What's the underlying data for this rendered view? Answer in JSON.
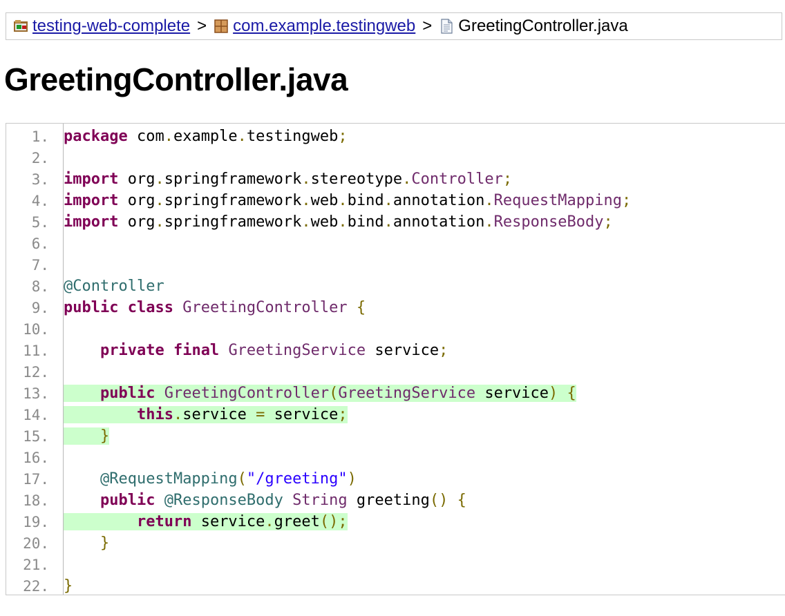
{
  "breadcrumb": {
    "project": "testing-web-complete",
    "separator1": ">",
    "package": "com.example.testingweb",
    "separator2": ">",
    "file": "GreetingController.java",
    "icons": [
      "project-icon",
      "package-icon",
      "java-file-icon"
    ]
  },
  "page_title": "GreetingController.java",
  "code": {
    "line_numbers": [
      "1.",
      "2.",
      "3.",
      "4.",
      "5.",
      "6.",
      "7.",
      "8.",
      "9.",
      "10.",
      "11.",
      "12.",
      "13.",
      "14.",
      "15.",
      "16.",
      "17.",
      "18.",
      "19.",
      "20.",
      "21.",
      "22."
    ],
    "lines": [
      [
        {
          "t": "package",
          "c": "kw"
        },
        {
          "t": " com"
        },
        {
          "t": ".",
          "c": "pn"
        },
        {
          "t": "example"
        },
        {
          "t": ".",
          "c": "pn"
        },
        {
          "t": "testingweb"
        },
        {
          "t": ";",
          "c": "pn"
        }
      ],
      [],
      [
        {
          "t": "import",
          "c": "kw"
        },
        {
          "t": " org"
        },
        {
          "t": ".",
          "c": "pn"
        },
        {
          "t": "springframework"
        },
        {
          "t": ".",
          "c": "pn"
        },
        {
          "t": "stereotype"
        },
        {
          "t": ".",
          "c": "pn"
        },
        {
          "t": "Controller",
          "c": "ty"
        },
        {
          "t": ";",
          "c": "pn"
        }
      ],
      [
        {
          "t": "import",
          "c": "kw"
        },
        {
          "t": " org"
        },
        {
          "t": ".",
          "c": "pn"
        },
        {
          "t": "springframework"
        },
        {
          "t": ".",
          "c": "pn"
        },
        {
          "t": "web"
        },
        {
          "t": ".",
          "c": "pn"
        },
        {
          "t": "bind"
        },
        {
          "t": ".",
          "c": "pn"
        },
        {
          "t": "annotation"
        },
        {
          "t": ".",
          "c": "pn"
        },
        {
          "t": "RequestMapping",
          "c": "ty"
        },
        {
          "t": ";",
          "c": "pn"
        }
      ],
      [
        {
          "t": "import",
          "c": "kw"
        },
        {
          "t": " org"
        },
        {
          "t": ".",
          "c": "pn"
        },
        {
          "t": "springframework"
        },
        {
          "t": ".",
          "c": "pn"
        },
        {
          "t": "web"
        },
        {
          "t": ".",
          "c": "pn"
        },
        {
          "t": "bind"
        },
        {
          "t": ".",
          "c": "pn"
        },
        {
          "t": "annotation"
        },
        {
          "t": ".",
          "c": "pn"
        },
        {
          "t": "ResponseBody",
          "c": "ty"
        },
        {
          "t": ";",
          "c": "pn"
        }
      ],
      [],
      [],
      [
        {
          "t": "@Controller",
          "c": "an"
        }
      ],
      [
        {
          "t": "public",
          "c": "kw"
        },
        {
          "t": " "
        },
        {
          "t": "class",
          "c": "kw"
        },
        {
          "t": " "
        },
        {
          "t": "GreetingController",
          "c": "ty"
        },
        {
          "t": " "
        },
        {
          "t": "{",
          "c": "pn"
        }
      ],
      [],
      [
        {
          "t": "    "
        },
        {
          "t": "private",
          "c": "kw"
        },
        {
          "t": " "
        },
        {
          "t": "final",
          "c": "kw"
        },
        {
          "t": " "
        },
        {
          "t": "GreetingService",
          "c": "ty"
        },
        {
          "t": " service"
        },
        {
          "t": ";",
          "c": "pn"
        }
      ],
      [],
      [
        {
          "t": "    "
        },
        {
          "t": "public",
          "c": "kw"
        },
        {
          "t": " "
        },
        {
          "t": "GreetingController",
          "c": "ty"
        },
        {
          "t": "(",
          "c": "pn"
        },
        {
          "t": "GreetingService",
          "c": "ty"
        },
        {
          "t": " service"
        },
        {
          "t": ")",
          "c": "pn"
        },
        {
          "t": " "
        },
        {
          "t": "{",
          "c": "pn"
        }
      ],
      [
        {
          "t": "        "
        },
        {
          "t": "this",
          "c": "kw"
        },
        {
          "t": ".",
          "c": "pn"
        },
        {
          "t": "service "
        },
        {
          "t": "=",
          "c": "pn"
        },
        {
          "t": " service"
        },
        {
          "t": ";",
          "c": "pn"
        }
      ],
      [
        {
          "t": "    "
        },
        {
          "t": "}",
          "c": "pn"
        }
      ],
      [],
      [
        {
          "t": "    "
        },
        {
          "t": "@RequestMapping",
          "c": "an"
        },
        {
          "t": "(",
          "c": "pn"
        },
        {
          "t": "\"/greeting\"",
          "c": "str"
        },
        {
          "t": ")",
          "c": "pn"
        }
      ],
      [
        {
          "t": "    "
        },
        {
          "t": "public",
          "c": "kw"
        },
        {
          "t": " "
        },
        {
          "t": "@ResponseBody",
          "c": "an"
        },
        {
          "t": " "
        },
        {
          "t": "String",
          "c": "ty"
        },
        {
          "t": " greeting"
        },
        {
          "t": "()",
          "c": "pn"
        },
        {
          "t": " "
        },
        {
          "t": "{",
          "c": "pn"
        }
      ],
      [
        {
          "t": "        "
        },
        {
          "t": "return",
          "c": "kw"
        },
        {
          "t": " service"
        },
        {
          "t": ".",
          "c": "pn"
        },
        {
          "t": "greet"
        },
        {
          "t": "();",
          "c": "pn"
        }
      ],
      [
        {
          "t": "    "
        },
        {
          "t": "}",
          "c": "pn"
        }
      ],
      [],
      [
        {
          "t": "}",
          "c": "pn"
        }
      ]
    ],
    "highlighted_lines": [
      13,
      14,
      15,
      19
    ]
  },
  "colors": {
    "keyword": "#7f0055",
    "type": "#6f2b6b",
    "annotation": "#2f6d6d",
    "string": "#2a00ff",
    "punctuation": "#7a6a00",
    "highlight": "#ccffcc",
    "link": "#1a1aa6"
  }
}
